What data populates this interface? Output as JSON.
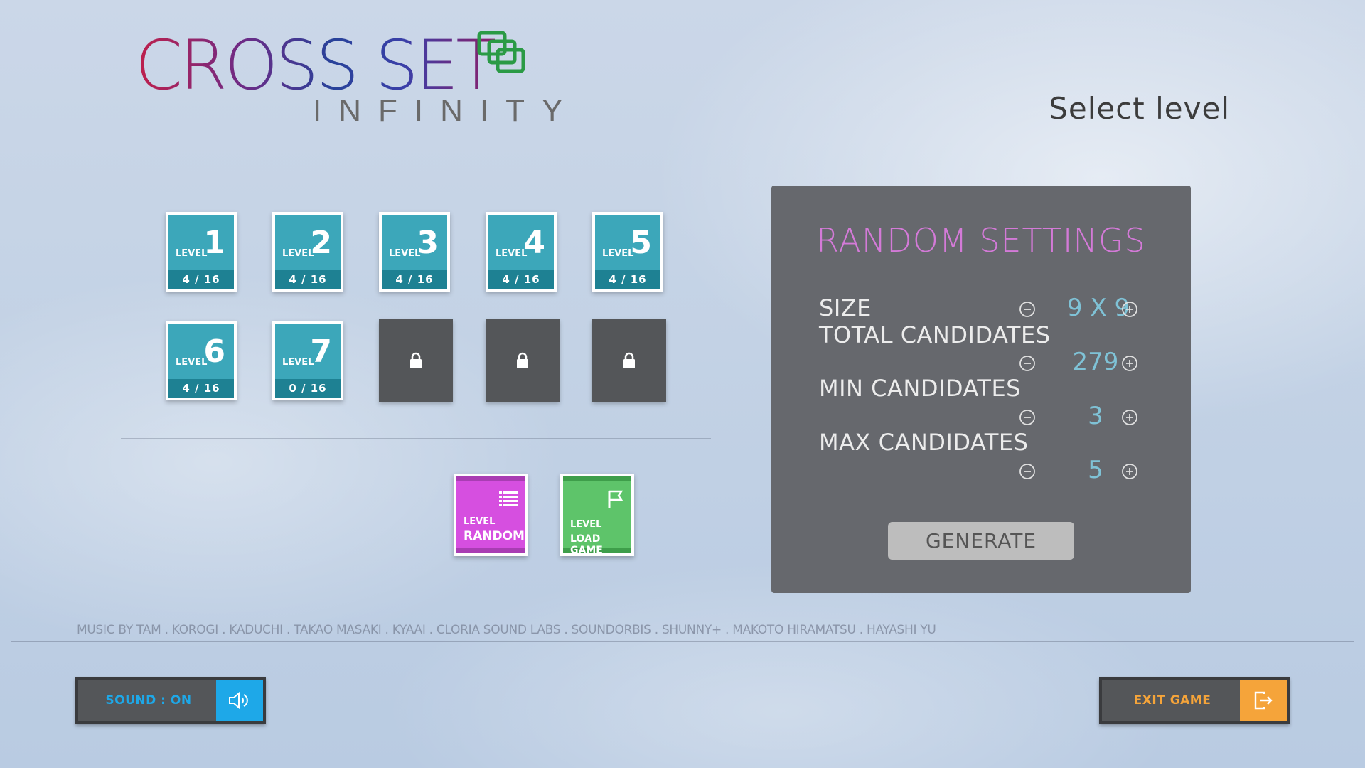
{
  "header": {
    "logo_title": "CROSS SET",
    "logo_subtitle": "INFINITY",
    "page_title": "Select level"
  },
  "levels": [
    {
      "label": "LEVEL",
      "number": "1",
      "progress": "4 / 16",
      "locked": false
    },
    {
      "label": "LEVEL",
      "number": "2",
      "progress": "4 / 16",
      "locked": false
    },
    {
      "label": "LEVEL",
      "number": "3",
      "progress": "4 / 16",
      "locked": false
    },
    {
      "label": "LEVEL",
      "number": "4",
      "progress": "4 / 16",
      "locked": false
    },
    {
      "label": "LEVEL",
      "number": "5",
      "progress": "4 / 16",
      "locked": false
    },
    {
      "label": "LEVEL",
      "number": "6",
      "progress": "4 / 16",
      "locked": false
    },
    {
      "label": "LEVEL",
      "number": "7",
      "progress": "0 / 16",
      "locked": false
    },
    {
      "locked": true
    },
    {
      "locked": true
    },
    {
      "locked": true
    }
  ],
  "special_levels": {
    "random": {
      "label": "LEVEL",
      "name": "RANDOM",
      "color": "#d64fe0",
      "band": "#a93db3",
      "icon": "list-icon"
    },
    "load": {
      "label": "LEVEL",
      "name": "LOAD GAME",
      "color": "#5ec46a",
      "band": "#3e9e4a",
      "icon": "flag-icon"
    }
  },
  "random_settings": {
    "title": "RANDOM SETTINGS",
    "size_label": "SIZE",
    "size_value": "9 X 9",
    "total_label": "TOTAL CANDIDATES",
    "total_value": "279",
    "min_label": "MIN CANDIDATES",
    "min_value": "3",
    "max_label": "MAX CANDIDATES",
    "max_value": "5",
    "generate_label": "GENERATE"
  },
  "credits": "MUSIC BY TAM . KOROGI . KADUCHI . TAKAO MASAKI . KYAAI . CLORIA SOUND LABS . SOUNDORBIS . SHUNNY+ . MAKOTO HIRAMATSU . HAYASHI YU",
  "footer": {
    "sound_label": "SOUND : ON",
    "sound_color": "#1ea8e8",
    "exit_label": "EXIT GAME",
    "exit_color": "#f5a43a"
  }
}
